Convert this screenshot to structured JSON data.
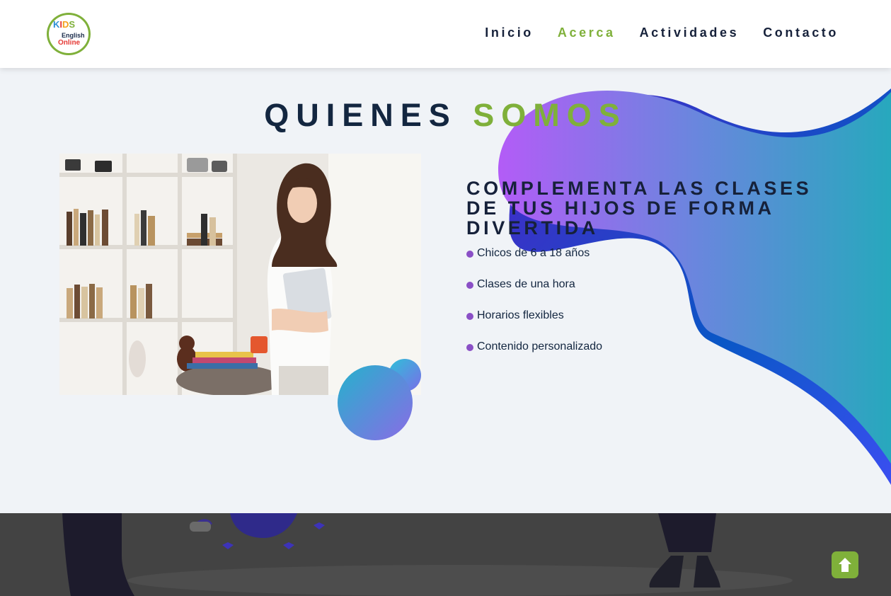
{
  "brand": {
    "logo_line1": "KIDS",
    "logo_line2": "English",
    "logo_line3": "Online"
  },
  "nav": {
    "items": [
      {
        "label": "Inicio",
        "active": false
      },
      {
        "label": "Acerca",
        "active": true
      },
      {
        "label": "Actividades",
        "active": false
      },
      {
        "label": "Contacto",
        "active": false
      }
    ]
  },
  "section": {
    "title_part1": "QUIENES",
    "title_part2": "SOMOS",
    "subheading": "COMPLEMENTA LAS CLASES DE TUS HIJOS DE FORMA DIVERTIDA",
    "features": [
      "Chicos de 6 a 18 años",
      "Clases de una hora",
      "Horarios flexibles",
      "Contenido personalizado"
    ]
  },
  "colors": {
    "accent_green": "#7fb03a",
    "navy": "#132640",
    "bullet_purple": "#8a4fc6",
    "blob_start": "#b35cf7",
    "blob_end": "#27a8bd",
    "footer_gray": "#434343"
  },
  "icons": {
    "back_to_top": "arrow-up-icon"
  }
}
